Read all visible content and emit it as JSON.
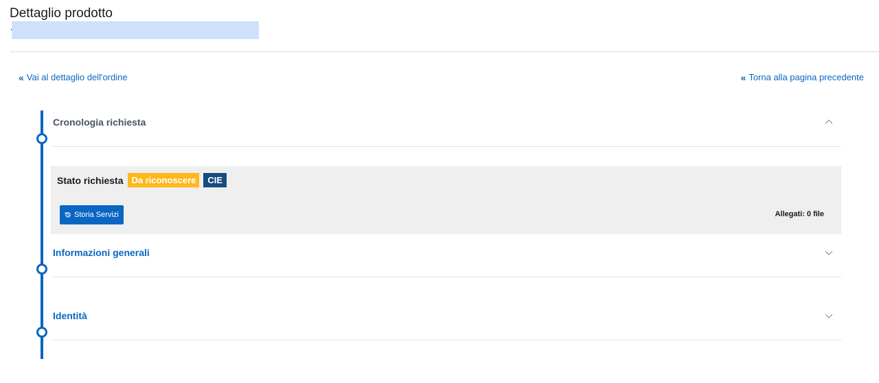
{
  "header": {
    "title": "Dettaglio prodotto"
  },
  "nav": {
    "left_link": "Vai al dettaglio dell'ordine",
    "right_link": "Torna alla pagina precedente"
  },
  "sections": {
    "cronologia": {
      "label": "Cronologia richiesta",
      "state": "expanded"
    },
    "informazioni": {
      "label": "Informazioni generali",
      "state": "collapsed"
    },
    "identita": {
      "label": "Identità",
      "state": "collapsed"
    }
  },
  "status": {
    "label": "Stato richiesta",
    "badge_state": "Da riconoscere",
    "badge_type": "CIE",
    "history_button": "Storia Servizi",
    "attachments": "Allegati: 0 file"
  },
  "colors": {
    "accent": "#0a66c2",
    "warning_badge": "#ffb81c",
    "dark_badge": "#174d7e",
    "panel_bg": "#efefef"
  }
}
